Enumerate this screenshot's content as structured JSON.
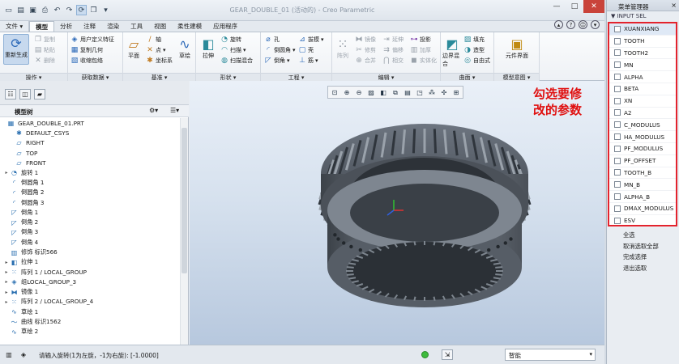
{
  "app": {
    "title": "GEAR_DOUBLE_01 (活动的) - Creo Parametric",
    "window_controls": [
      "—",
      "□",
      "✕"
    ]
  },
  "quick_access": {
    "icons": [
      "new-icon",
      "open-icon",
      "save-icon",
      "print-icon",
      "undo-icon",
      "redo-icon",
      "regenerate-icon",
      "window-icon",
      "close-window-icon"
    ]
  },
  "tabs": [
    {
      "label": "文件",
      "active": false
    },
    {
      "label": "模型",
      "active": true
    },
    {
      "label": "分析",
      "active": false
    },
    {
      "label": "注释",
      "active": false
    },
    {
      "label": "渲染",
      "active": false
    },
    {
      "label": "工具",
      "active": false
    },
    {
      "label": "视图",
      "active": false
    },
    {
      "label": "柔性建模",
      "active": false
    },
    {
      "label": "应用程序",
      "active": false
    }
  ],
  "ribbon": {
    "groups": {
      "operations": {
        "label": "操作 ▾",
        "regen": "重新生成",
        "copy": "复制",
        "paste": "粘贴",
        "delete": "删除"
      },
      "get_data": {
        "label": "获取数据 ▾",
        "udf": "用户定义特征",
        "copy_geom": "复制几何",
        "shrinkwrap": "收缩包络"
      },
      "datum": {
        "label": "基准 ▾",
        "plane": "平面",
        "axis": "轴",
        "point": "点",
        "csys": "坐标系",
        "sketch": "草绘"
      },
      "shapes": {
        "label": "形状 ▾",
        "extrude": "拉伸",
        "revolve": "旋转",
        "sweep": "扫描",
        "swept_blend": "扫描混合"
      },
      "engineering": {
        "label": "工程 ▾",
        "hole": "孔",
        "round": "倒圆角",
        "chamfer": "倒角",
        "draft": "拔模",
        "shell": "壳",
        "rib": "筋"
      },
      "editing": {
        "label": "编辑 ▾",
        "pattern": "阵列",
        "mirror": "镜像",
        "trim": "修剪",
        "merge": "合并",
        "extend": "延伸",
        "offset": "偏移",
        "intersect": "相交",
        "project": "投影",
        "thicken": "加厚",
        "solidify": "实体化"
      },
      "surfaces": {
        "label": "曲面 ▾",
        "boundary": "边界混合",
        "fill": "填充",
        "style": "造型",
        "freestyle": "自由式"
      },
      "model_intent": {
        "label": "模型意图 ▾",
        "component_interface": "元件界面"
      }
    }
  },
  "model_tree": {
    "title": "模型树",
    "items": [
      {
        "label": "GEAR_DOUBLE_01.PRT",
        "icon": "part-icon",
        "expand": ""
      },
      {
        "label": "DEFAULT_CSYS",
        "icon": "csys-icon",
        "expand": ""
      },
      {
        "label": "RIGHT",
        "icon": "plane-icon",
        "expand": ""
      },
      {
        "label": "TOP",
        "icon": "plane-icon",
        "expand": ""
      },
      {
        "label": "FRONT",
        "icon": "plane-icon",
        "expand": ""
      },
      {
        "label": "旋转 1",
        "icon": "revolve-icon",
        "expand": "▸"
      },
      {
        "label": "倒圆角 1",
        "icon": "round-icon",
        "expand": ""
      },
      {
        "label": "倒圆角 2",
        "icon": "round-icon",
        "expand": ""
      },
      {
        "label": "倒圆角 3",
        "icon": "round-icon",
        "expand": ""
      },
      {
        "label": "倒角 1",
        "icon": "chamfer-icon",
        "expand": ""
      },
      {
        "label": "倒角 2",
        "icon": "chamfer-icon",
        "expand": ""
      },
      {
        "label": "倒角 3",
        "icon": "chamfer-icon",
        "expand": ""
      },
      {
        "label": "倒角 4",
        "icon": "chamfer-icon",
        "expand": ""
      },
      {
        "label": "修饰 标识566",
        "icon": "cosmetic-icon",
        "expand": ""
      },
      {
        "label": "拉伸 1",
        "icon": "extrude-icon",
        "expand": "▸"
      },
      {
        "label": "阵列 1 / LOCAL_GROUP",
        "icon": "pattern-icon",
        "expand": "▸"
      },
      {
        "label": "组LOCAL_GROUP_3",
        "icon": "group-icon",
        "expand": "▸"
      },
      {
        "label": "镜像 1",
        "icon": "mirror-icon",
        "expand": "▸"
      },
      {
        "label": "阵列 2 / LOCAL_GROUP_4",
        "icon": "pattern-icon",
        "expand": "▸"
      },
      {
        "label": "草绘 1",
        "icon": "sketch-icon",
        "expand": ""
      },
      {
        "label": "曲线 标识1562",
        "icon": "curve-icon",
        "expand": ""
      },
      {
        "label": "草绘 2",
        "icon": "sketch-icon",
        "expand": ""
      }
    ]
  },
  "view_toolbar": {
    "icons": [
      "refit-icon",
      "zoom-in-icon",
      "zoom-out-icon",
      "repaint-icon",
      "display-style-icon",
      "saved-views-icon",
      "view-manager-icon",
      "perspective-icon",
      "datum-display-icon",
      "spin-center-icon",
      "annotation-display-icon"
    ]
  },
  "annotation": {
    "line1": "勾选要修",
    "line2": "改的参数"
  },
  "status": {
    "message": "请输入旋转(1为左旋，-1为右旋): [-1.0000]",
    "filter": "智能"
  },
  "menu_manager": {
    "title": "菜单管理器",
    "close": "×",
    "subtitle": "▼ INPUT SEL",
    "params": [
      {
        "label": "XUANXIANG",
        "selected": true
      },
      {
        "label": "TOOTH",
        "selected": false
      },
      {
        "label": "TOOTH2",
        "selected": false
      },
      {
        "label": "MN",
        "selected": false
      },
      {
        "label": "ALPHA",
        "selected": false
      },
      {
        "label": "BETA",
        "selected": false
      },
      {
        "label": "XN",
        "selected": false
      },
      {
        "label": "A2",
        "selected": false
      },
      {
        "label": "C_MODULUS",
        "selected": false
      },
      {
        "label": "HA_MODULUS",
        "selected": false
      },
      {
        "label": "PF_MODULUS",
        "selected": false
      },
      {
        "label": "PF_OFFSET",
        "selected": false
      },
      {
        "label": "TOOTH_B",
        "selected": false
      },
      {
        "label": "MN_B",
        "selected": false
      },
      {
        "label": "ALPHA_B",
        "selected": false
      },
      {
        "label": "DMAX_MODULUS",
        "selected": false
      },
      {
        "label": "ESV",
        "selected": false
      }
    ],
    "actions": [
      "全选",
      "取消选取全部",
      "完成选择",
      "退出选取"
    ]
  },
  "colors": {
    "accent_red": "#e3232d",
    "note_red": "#e01010",
    "viewport_top": "#eaf0f8",
    "viewport_bottom": "#b7c8de"
  }
}
